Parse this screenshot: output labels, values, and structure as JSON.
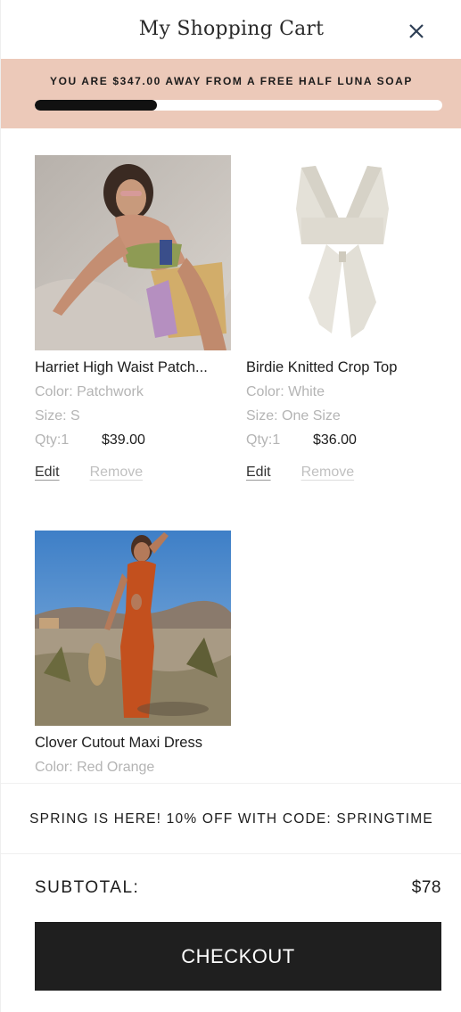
{
  "header": {
    "title": "My Shopping Cart",
    "close_icon": "close-icon"
  },
  "banner": {
    "message": "YOU ARE $347.00 AWAY FROM A FREE HALF LUNA SOAP",
    "progress_fraction": 0.3,
    "bg_color": "#ecc9b9"
  },
  "items": [
    {
      "name": "Harriet High Waist Patch...",
      "color": "Color: Patchwork",
      "size": "Size: S",
      "qty": "Qty:1",
      "price": "$39.00",
      "edit_label": "Edit",
      "remove_label": "Remove"
    },
    {
      "name": "Birdie Knitted Crop Top",
      "color": "Color: White",
      "size": "Size: One Size",
      "qty": "Qty:1",
      "price": "$36.00",
      "edit_label": "Edit",
      "remove_label": "Remove"
    },
    {
      "name": "Clover Cutout Maxi Dress",
      "color": "Color: Red Orange"
    }
  ],
  "promo": {
    "text": "SPRING IS HERE! 10% OFF WITH CODE: SPRINGTIME"
  },
  "summary": {
    "subtotal_label": "SUBTOTAL:",
    "subtotal_value": "$78",
    "checkout_label": "CHECKOUT"
  }
}
